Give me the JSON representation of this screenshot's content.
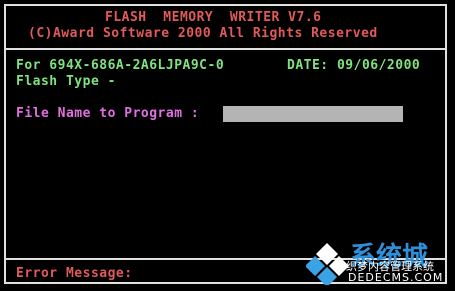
{
  "header": {
    "title": "FLASH  MEMORY  WRITER V7.6",
    "copyright": "(C)Award Software 2000 All Rights Reserved"
  },
  "info": {
    "bios_id": "For 694X-686A-2A6LJPA9C-0",
    "date": "DATE: 09/06/2000",
    "flash_type": "Flash Type -"
  },
  "prompt": {
    "label": "File Name to Program :",
    "value": ""
  },
  "footer": {
    "error_label": "Error Message:"
  },
  "watermark": {
    "brand": "系统城",
    "tagline": "织梦内容管理系统",
    "url": "DEDECMS.COM"
  },
  "colors": {
    "background": "#000000",
    "frame": "#e0e0e0",
    "title_red": "#e05a5a",
    "info_green": "#7fe27f",
    "prompt_magenta": "#e070e0",
    "input_gray": "#b4b4b4"
  }
}
